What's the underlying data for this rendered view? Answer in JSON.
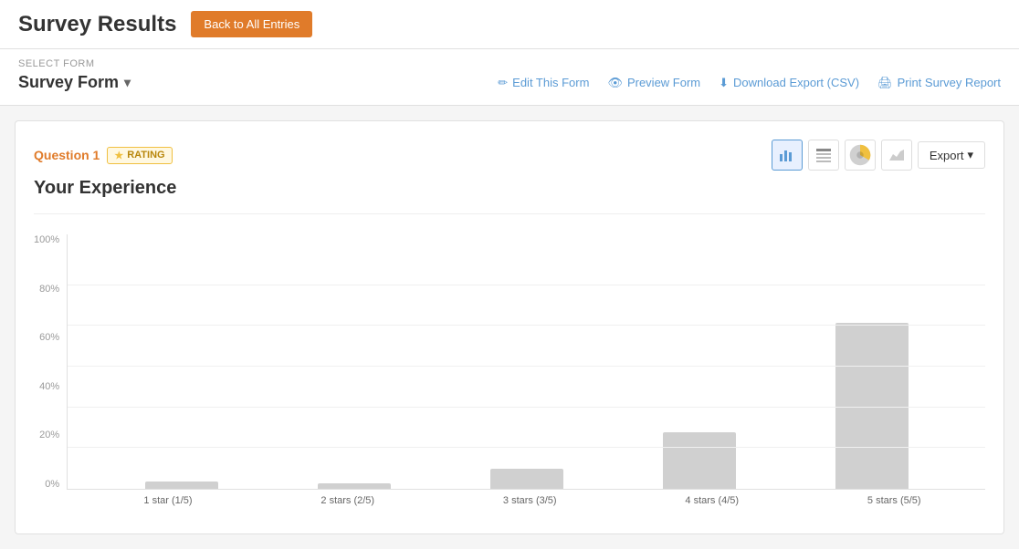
{
  "header": {
    "title": "Survey Results",
    "back_button": "Back to All Entries"
  },
  "sub_header": {
    "select_form_label": "SELECT FORM",
    "form_name": "Survey Form",
    "toolbar": {
      "edit_label": "Edit This Form",
      "preview_label": "Preview Form",
      "download_label": "Download Export (CSV)",
      "print_label": "Print Survey Report"
    }
  },
  "question": {
    "number": "Question 1",
    "type": "RATING",
    "title": "Your Experience",
    "export_label": "Export"
  },
  "chart": {
    "y_labels": [
      "100%",
      "80%",
      "60%",
      "40%",
      "20%",
      "0%"
    ],
    "bars": [
      {
        "label": "1 star (1/5)",
        "height_pct": 3
      },
      {
        "label": "2 stars (2/5)",
        "height_pct": 2
      },
      {
        "label": "3 stars (3/5)",
        "height_pct": 8
      },
      {
        "label": "4 stars (4/5)",
        "height_pct": 22
      },
      {
        "label": "5 stars (5/5)",
        "height_pct": 65
      }
    ]
  }
}
